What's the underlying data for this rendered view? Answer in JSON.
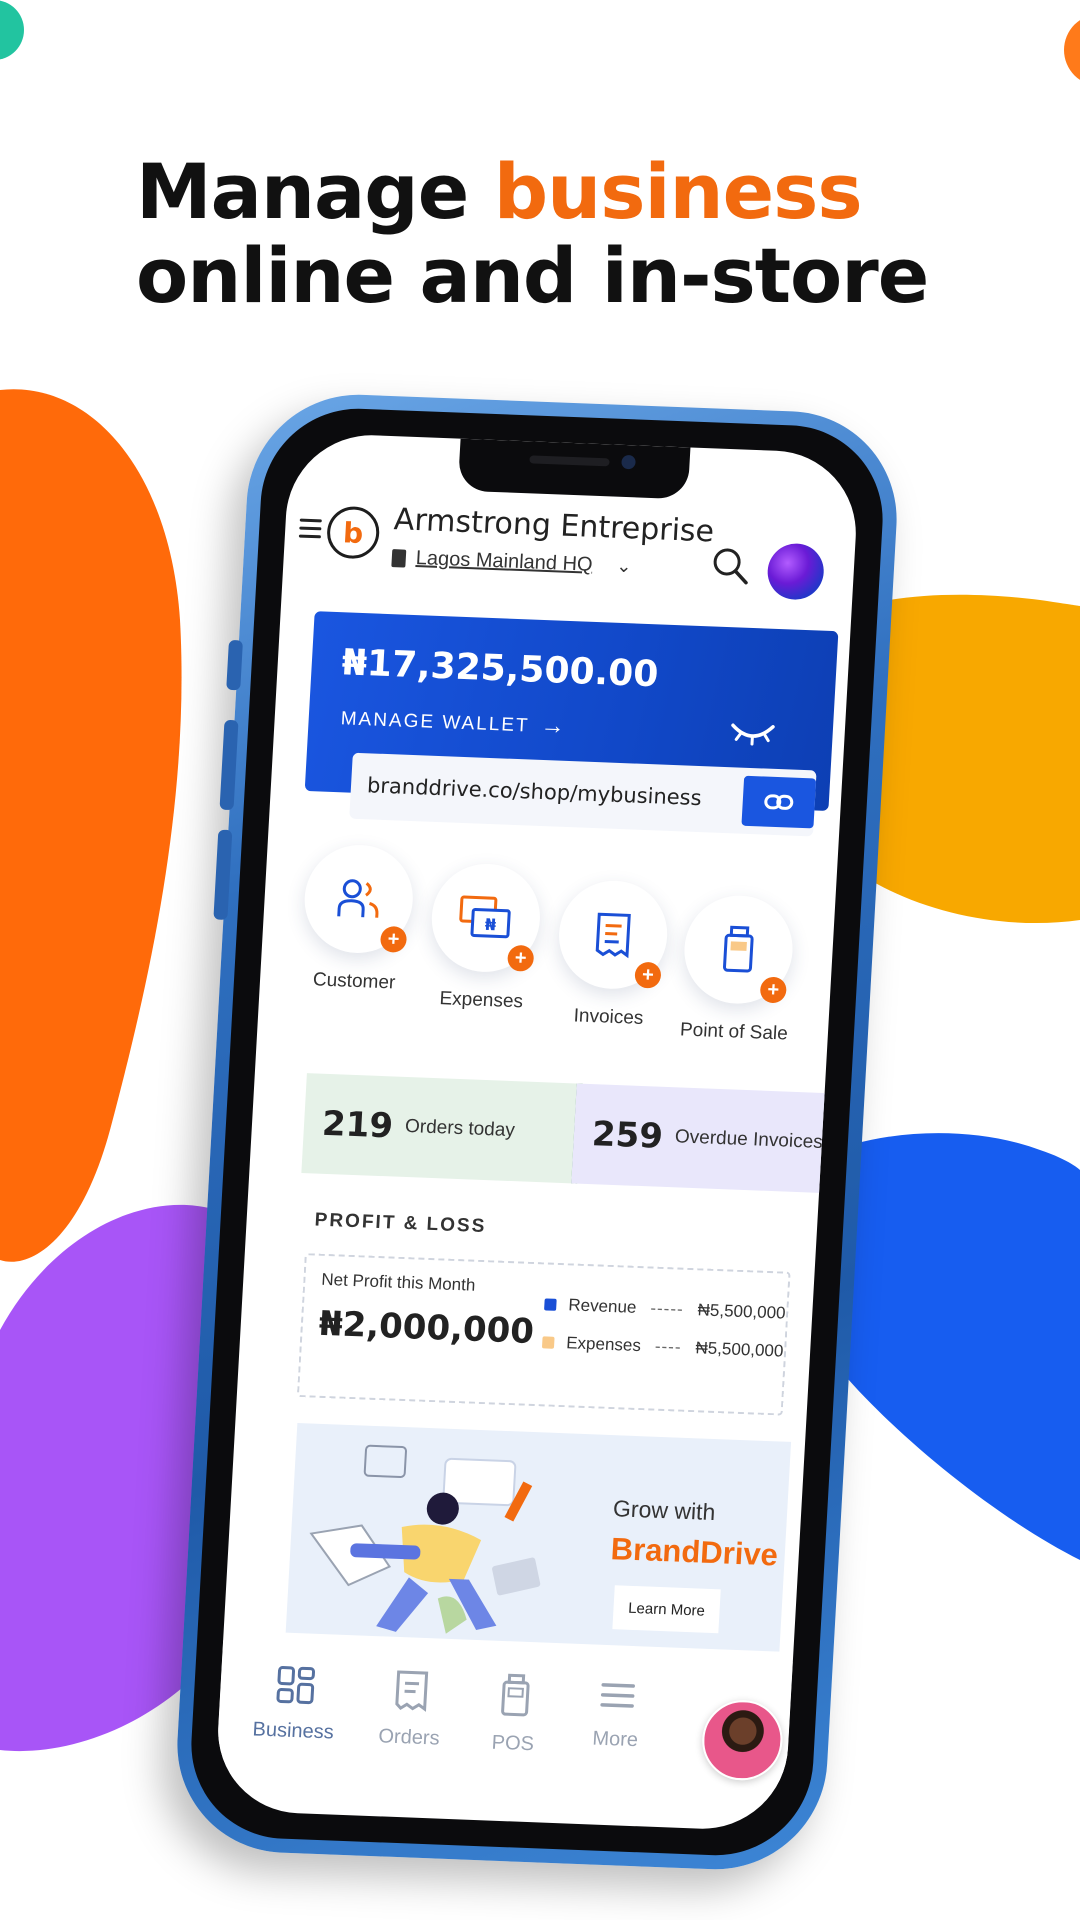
{
  "headline": {
    "line1_plain": "Manage ",
    "line1_accent": "business",
    "line2": "online and in-store"
  },
  "colors": {
    "accent_orange": "#f26a0f",
    "wallet_blue": "#1a56e0",
    "blob_purple": "#a855f7",
    "blob_yellow": "#f8a800",
    "blob_blue": "#175df0"
  },
  "app": {
    "business_name": "Armstrong Entreprise",
    "location": "Lagos Mainland HQ",
    "icons": {
      "menu": "menu-icon",
      "search": "search-icon",
      "location": "building-icon",
      "dropdown": "chevron-down-icon"
    }
  },
  "wallet": {
    "balance": "₦17,325,500.00",
    "manage_label": "MANAGE WALLET",
    "shop_url": "branddrive.co/shop/mybusiness"
  },
  "quick_actions": [
    {
      "label": "Customer",
      "icon": "customer-icon"
    },
    {
      "label": "Expenses",
      "icon": "expenses-icon"
    },
    {
      "label": "Invoices",
      "icon": "invoices-icon"
    },
    {
      "label": "Point of Sale",
      "icon": "pos-icon"
    }
  ],
  "stats": {
    "orders": {
      "value": "219",
      "label": "Orders today"
    },
    "overdue": {
      "value": "259",
      "label": "Overdue Invoices"
    }
  },
  "profit_loss": {
    "title": "PROFIT & LOSS",
    "net_profit_label": "Net Profit this Month",
    "net_profit_value": "₦2,000,000",
    "legend": [
      {
        "name": "Revenue",
        "value": "₦5,500,000",
        "color": "#1a4fd6"
      },
      {
        "name": "Expenses",
        "value": "₦5,500,000",
        "color": "#f9c988"
      }
    ]
  },
  "banner": {
    "grow_text": "Grow with",
    "brand_text": "BrandDrive",
    "cta": "Learn More"
  },
  "bottom_nav": [
    {
      "label": "Business",
      "icon": "grid-icon",
      "active": true
    },
    {
      "label": "Orders",
      "icon": "receipt-icon",
      "active": false
    },
    {
      "label": "POS",
      "icon": "pos-terminal-icon",
      "active": false
    },
    {
      "label": "More",
      "icon": "hamburger-icon",
      "active": false
    }
  ]
}
